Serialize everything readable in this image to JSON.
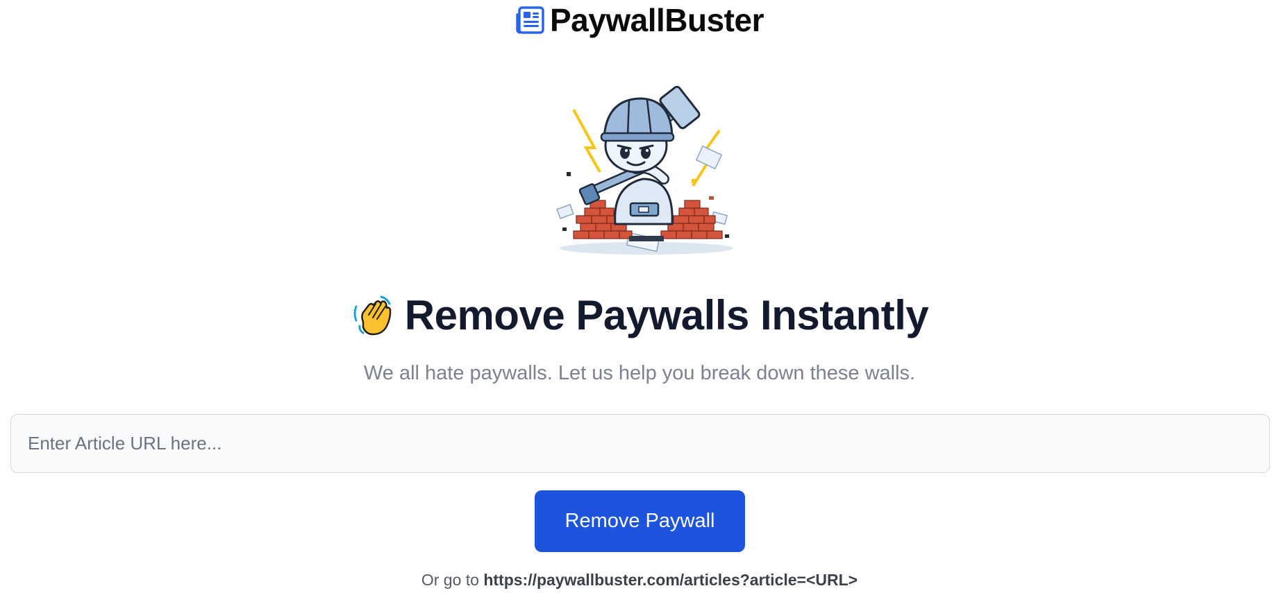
{
  "brand": {
    "name": "PaywallBuster",
    "icon": "newspaper-icon",
    "accent_color": "#2563eb"
  },
  "mascot": {
    "icon": "hammer-worker-breaking-brick-wall-illustration"
  },
  "hero": {
    "icon": "waving-hand-icon",
    "title": "Remove Paywalls Instantly",
    "subtitle": "We all hate paywalls. Let us help you break down these walls."
  },
  "form": {
    "url_placeholder": "Enter Article URL here...",
    "url_value": "",
    "submit_label": "Remove Paywall",
    "submit_color": "#1c54de"
  },
  "footer_hint": {
    "prefix": "Or go to",
    "url_pattern": "https://paywallbuster.com/articles?article=<URL>"
  }
}
